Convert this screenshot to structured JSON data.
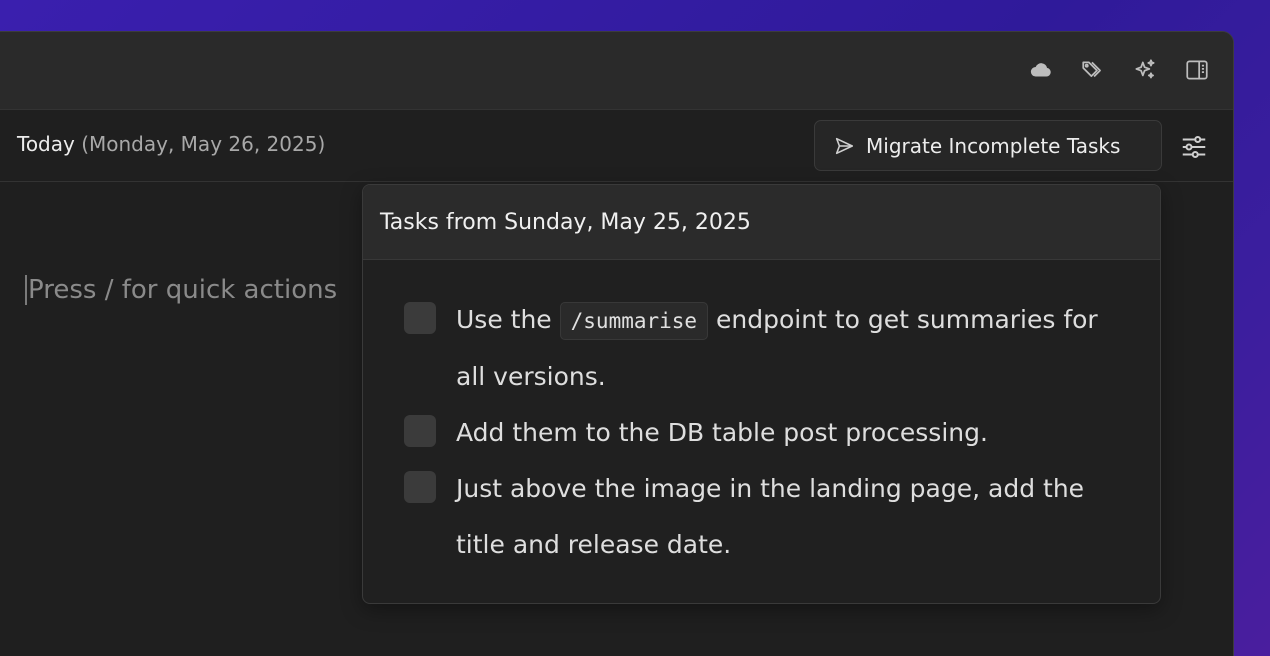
{
  "titlebar": {
    "icons": [
      "cloud-icon",
      "tags-icon",
      "sparkles-icon",
      "sidebar-toggle-icon"
    ]
  },
  "day_header": {
    "label": "Today",
    "date": "(Monday, May 26, 2025)",
    "migrate_label": "Migrate Incomplete Tasks"
  },
  "editor": {
    "placeholder": "Press / for quick actions"
  },
  "popover": {
    "title": "Tasks from Sunday, May 25, 2025",
    "tasks": [
      {
        "before": "Use the ",
        "code": "/summarise",
        "after": " endpoint to get summaries for all versions.",
        "checked": false
      },
      {
        "text": "Add them to the DB table post processing.",
        "checked": false
      },
      {
        "text": "Just above the image in the landing page, add the title and release date.",
        "checked": false
      }
    ]
  },
  "colors": {
    "background_gradient": "#3a1fae",
    "window_bg": "#1f1f1f",
    "titlebar_bg": "#2a2a2a",
    "text_primary": "#ececec",
    "text_secondary": "#a8a8a8"
  }
}
